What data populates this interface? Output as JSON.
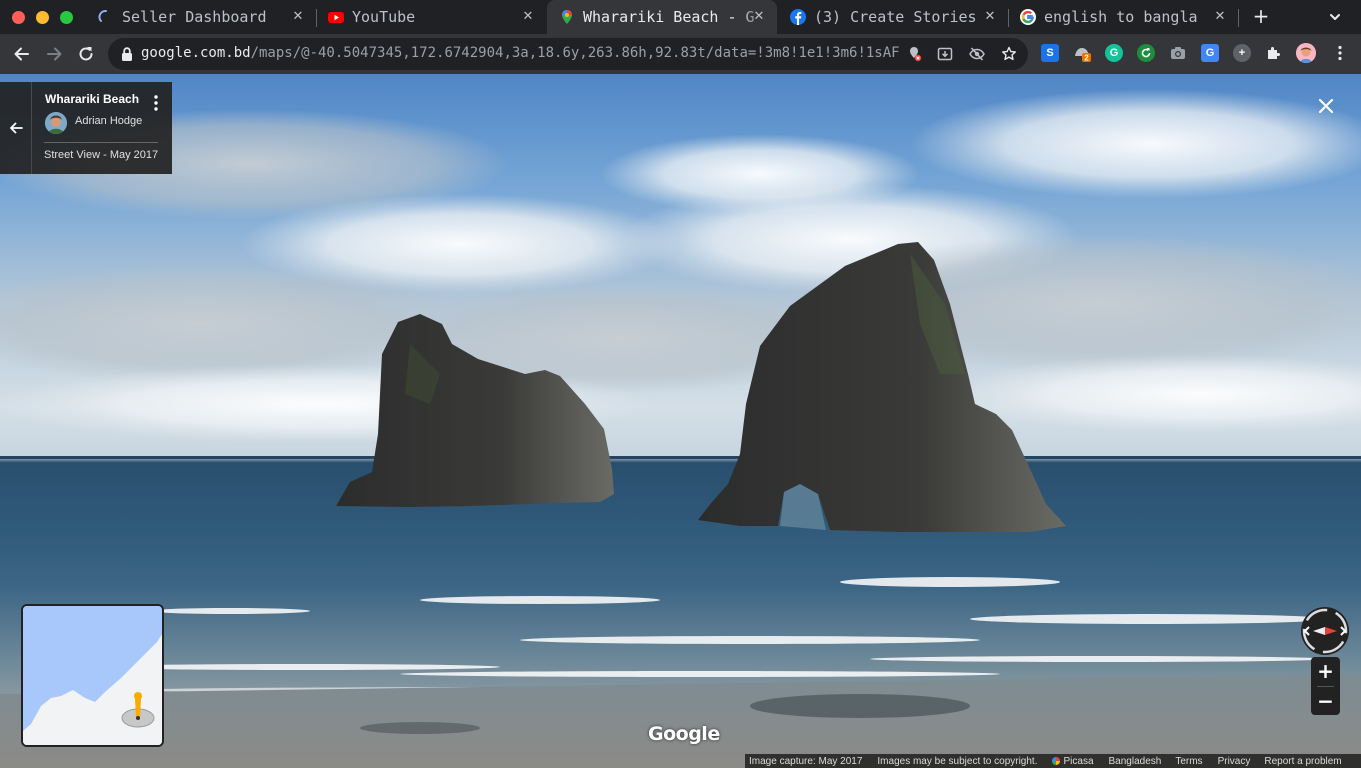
{
  "browser": {
    "tabs": [
      {
        "title": "Seller Dashboard",
        "icon": "loading-spinner-icon",
        "active": false
      },
      {
        "title": "YouTube",
        "icon": "youtube-icon",
        "active": false
      },
      {
        "title": "Wharariki Beach - G",
        "icon": "google-maps-pin-icon",
        "active": true
      },
      {
        "title": "(3) Create Stories",
        "icon": "facebook-icon",
        "active": false
      },
      {
        "title": "english to bangla",
        "icon": "google-icon",
        "active": false
      }
    ],
    "tab_close_glyph": "✕",
    "new_tab_glyph": "+",
    "url_host": "google.com.bd",
    "url_path": "/maps/@-40.5047345,172.6742904,3a,18.6y,263.86h,92.83t/data=!3m8!1e1!3m6!1sAF1Qi…",
    "extensions": [
      {
        "name": "s-extension-icon",
        "label": "S",
        "color": "#1a73e8"
      },
      {
        "name": "fox-extension-icon",
        "label": "2",
        "color": "#e37400"
      },
      {
        "name": "grammarly-icon",
        "label": "G",
        "color": "#15c39a"
      },
      {
        "name": "refresh-extension-icon",
        "label": "",
        "color": "#1e8e3e"
      },
      {
        "name": "camera-extension-icon",
        "label": "",
        "color": "#9aa0a6"
      },
      {
        "name": "google-translate-icon",
        "label": "G",
        "color": "#4285f4"
      },
      {
        "name": "plus-circle-extension-icon",
        "label": "+",
        "color": "#5f6368"
      }
    ]
  },
  "streetview": {
    "place_name": "Wharariki Beach",
    "author": "Adrian Hodge",
    "capture_label": "Street View - May 2017",
    "watermark": "Google",
    "zoom_in": "+",
    "zoom_out": "−",
    "footer": {
      "capture": "Image capture: May 2017",
      "copyright": "Images may be subject to copyright.",
      "provider": "Picasa",
      "country": "Bangladesh",
      "terms": "Terms",
      "privacy": "Privacy",
      "report": "Report a problem"
    }
  },
  "colors": {
    "tabstrip": "#202124",
    "toolbar": "#35363a",
    "accent_red": "#ea4335",
    "water_map": "#a8c7fa"
  }
}
